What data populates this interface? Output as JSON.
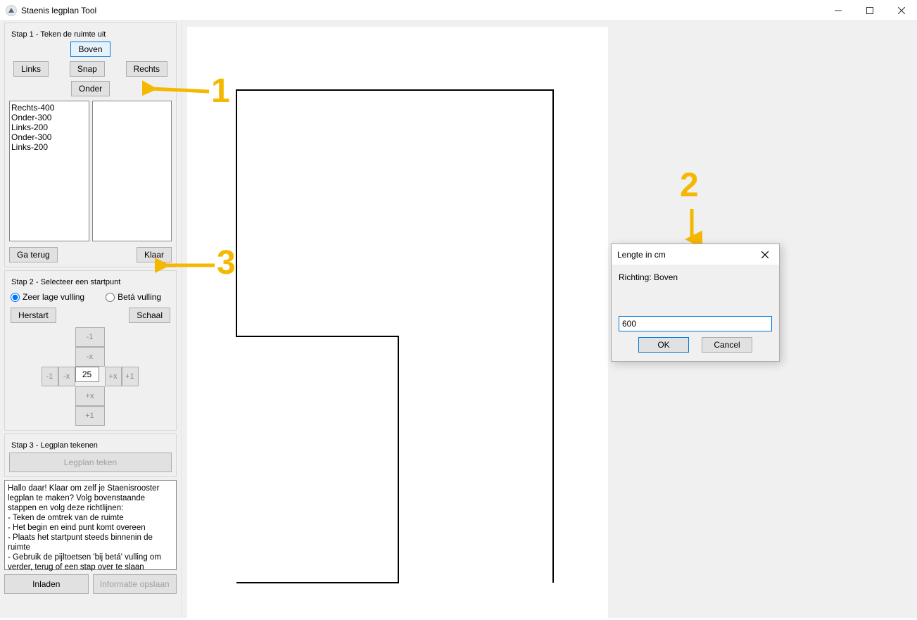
{
  "app_title": "Staenis legplan Tool",
  "step1": {
    "legend": "Stap 1 - Teken de ruimte uit",
    "btn_boven": "Boven",
    "btn_links": "Links",
    "btn_snap": "Snap",
    "btn_rechts": "Rechts",
    "btn_onder": "Onder",
    "segments": [
      "Rechts-400",
      "Onder-300",
      "Links-200",
      "Onder-300",
      "Links-200"
    ],
    "btn_gaterug": "Ga terug",
    "btn_klaar": "Klaar"
  },
  "step2": {
    "legend": "Stap 2 - Selecteer een startpunt",
    "radio_zeer": "Zeer lage vulling",
    "radio_beta": "Betá vulling",
    "btn_herstart": "Herstart",
    "btn_schaal": "Schaal",
    "pad": {
      "minus1": "-1",
      "minusx": "-x",
      "plusx": "+x",
      "plus1": "+1",
      "center": "25"
    }
  },
  "step3": {
    "legend": "Stap 3 - Legplan tekenen",
    "btn_legplan": "Legplan teken"
  },
  "help_text": "Hallo daar! Klaar om zelf je Staenisrooster legplan te maken? Volg bovenstaande stappen en volg deze richtlijnen:\n- Teken de omtrek van de ruimte\n- Het begin en eind punt komt overeen\n- Plaats het startpunt steeds binnenin de ruimte\n- Gebruik de pijltoetsen 'bij betá' vulling om verder, terug of een stap over te slaan",
  "btn_inladen": "Inladen",
  "btn_info_opslaan": "Informatie opslaan",
  "dialog": {
    "title": "Lengte in cm",
    "message": "Richting: Boven",
    "input_value": "600",
    "ok": "OK",
    "cancel": "Cancel"
  },
  "annotations": {
    "n1": "1",
    "n2": "2",
    "n3": "3"
  }
}
